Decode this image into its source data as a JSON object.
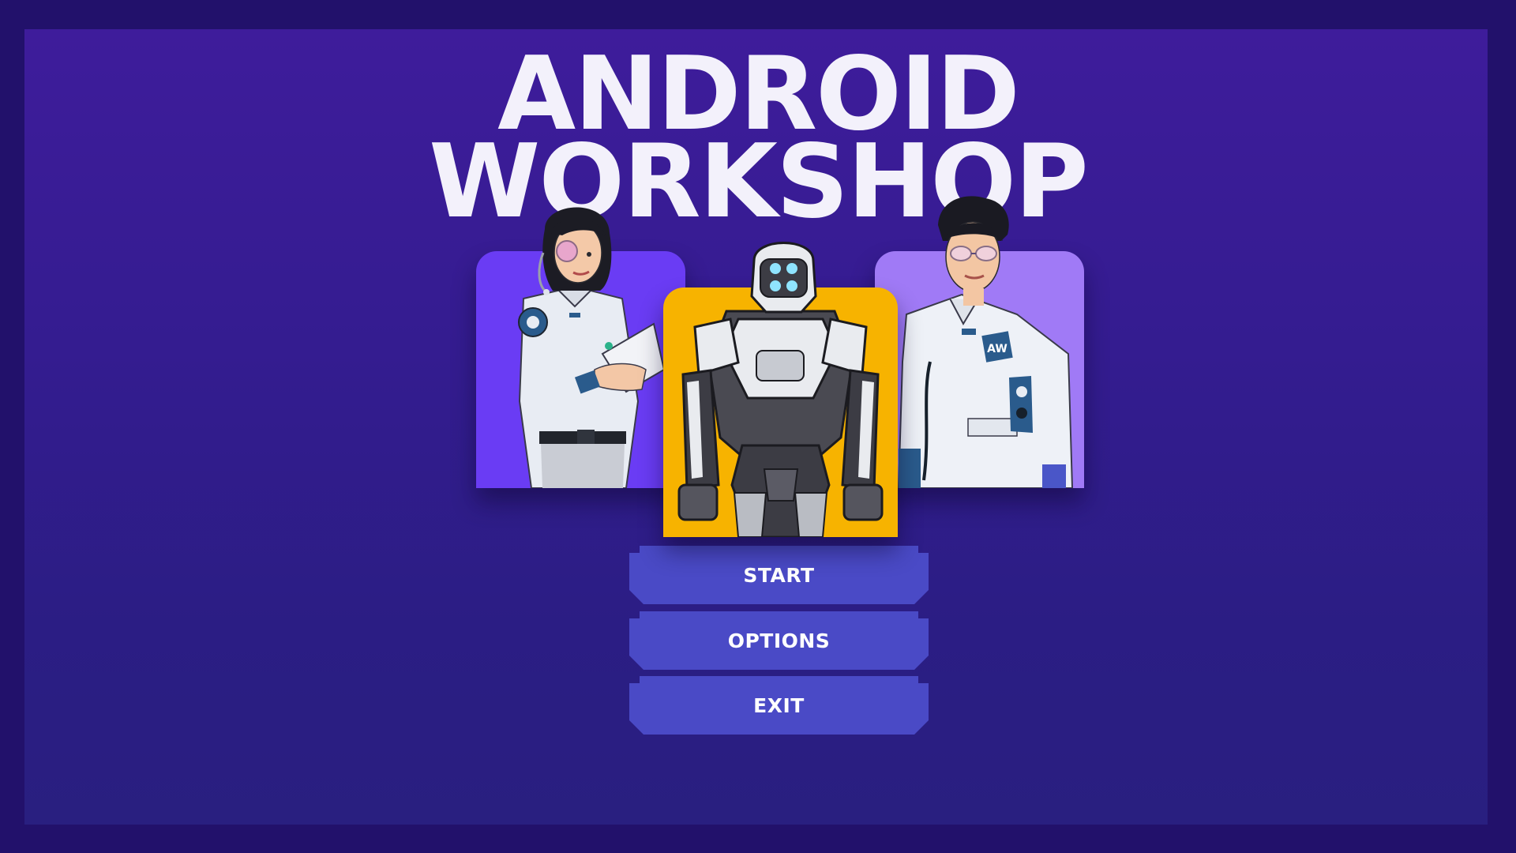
{
  "title": {
    "line1": "ANDROID",
    "line2": "WORKSHOP"
  },
  "characters": {
    "left": {
      "icon": "female-scientist-icon",
      "card_color": "#6a3cf4"
    },
    "center": {
      "icon": "robot-icon",
      "card_color": "#f7b300"
    },
    "right": {
      "icon": "male-scientist-icon",
      "card_color": "#a07af6",
      "badge_text": "AW"
    }
  },
  "menu": {
    "start_label": "START",
    "options_label": "OPTIONS",
    "exit_label": "EXIT"
  },
  "colors": {
    "outer_background": "#22116b",
    "panel_background": "#3e1c9b",
    "button": "#4a4ac6",
    "title_text": "#f3f1fb"
  }
}
